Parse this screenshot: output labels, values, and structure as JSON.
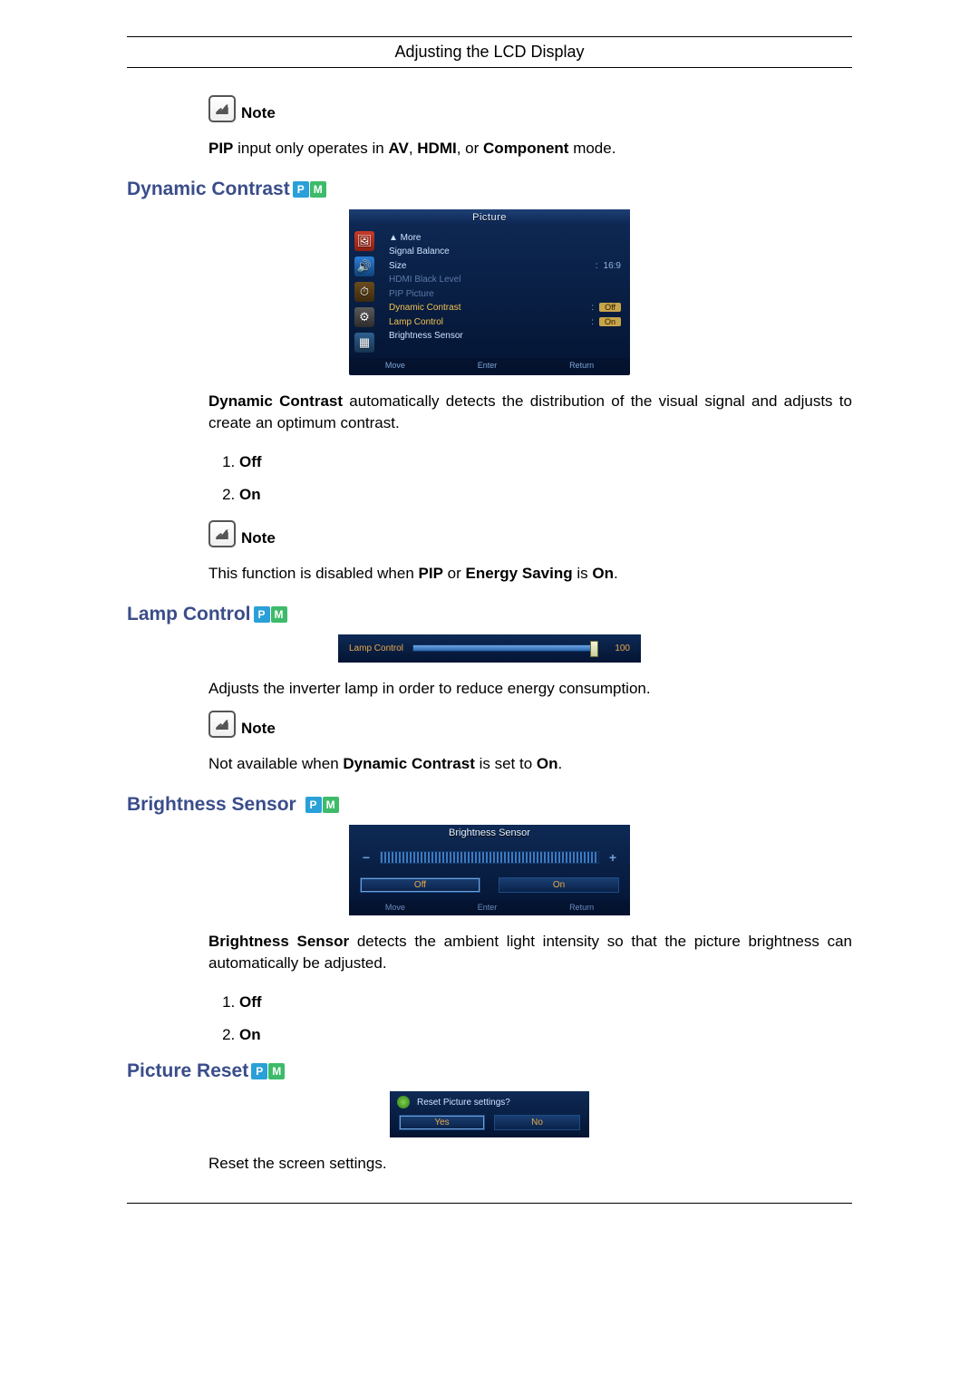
{
  "header": {
    "title": "Adjusting the LCD Display"
  },
  "labels": {
    "note": "Note",
    "badge_p": "P",
    "badge_m": "M"
  },
  "pip_note": {
    "pre": "PIP",
    "mid1": " input only operates in ",
    "av": "AV",
    "c1": ", ",
    "hdmi": "HDMI",
    "c2": ", or ",
    "comp": "Component",
    "post": " mode."
  },
  "sections": {
    "dynamic_contrast": {
      "title": "Dynamic Contrast",
      "desc_lead": "Dynamic Contrast",
      "desc_rest": " automatically detects the distribution of the visual signal and adjusts to create an optimum contrast.",
      "options": [
        "Off",
        "On"
      ],
      "note_pre": "This function is disabled when ",
      "note_b1": "PIP",
      "note_mid": " or ",
      "note_b2": "Energy Saving",
      "note_mid2": " is ",
      "note_b3": "On",
      "note_post": "."
    },
    "lamp_control": {
      "title": "Lamp Control",
      "desc": "Adjusts the inverter lamp in order to reduce energy consumption.",
      "note_pre": "Not available when ",
      "note_b1": "Dynamic Contrast",
      "note_mid": " is set to ",
      "note_b2": "On",
      "note_post": "."
    },
    "brightness_sensor": {
      "title": "Brightness Sensor",
      "desc_lead": "Brightness Sensor",
      "desc_rest": " detects the ambient light intensity so that the picture brightness can automatically be adjusted.",
      "options": [
        "Off",
        "On"
      ]
    },
    "picture_reset": {
      "title": "Picture Reset",
      "desc": "Reset the screen settings."
    }
  },
  "osd_picture": {
    "title": "Picture",
    "items": {
      "more": "▲ More",
      "signal_balance": "Signal Balance",
      "size": "Size",
      "size_val": "16:9",
      "hdmi_black": "HDMI Black Level",
      "pip_picture": "PIP Picture",
      "dynamic_contrast": "Dynamic Contrast",
      "dc_val": "Off",
      "lamp_control": "Lamp Control",
      "lc_val": "On",
      "brightness_sensor": "Brightness Sensor"
    },
    "footer": {
      "move": "Move",
      "enter": "Enter",
      "return": "Return"
    }
  },
  "osd_lamp": {
    "label": "Lamp Control",
    "value": "100"
  },
  "osd_bright": {
    "title": "Brightness Sensor",
    "minus": "−",
    "plus": "+",
    "off": "Off",
    "on": "On",
    "footer": {
      "move": "Move",
      "enter": "Enter",
      "return": "Return"
    }
  },
  "osd_reset": {
    "prompt": "Reset Picture settings?",
    "yes": "Yes",
    "no": "No"
  }
}
